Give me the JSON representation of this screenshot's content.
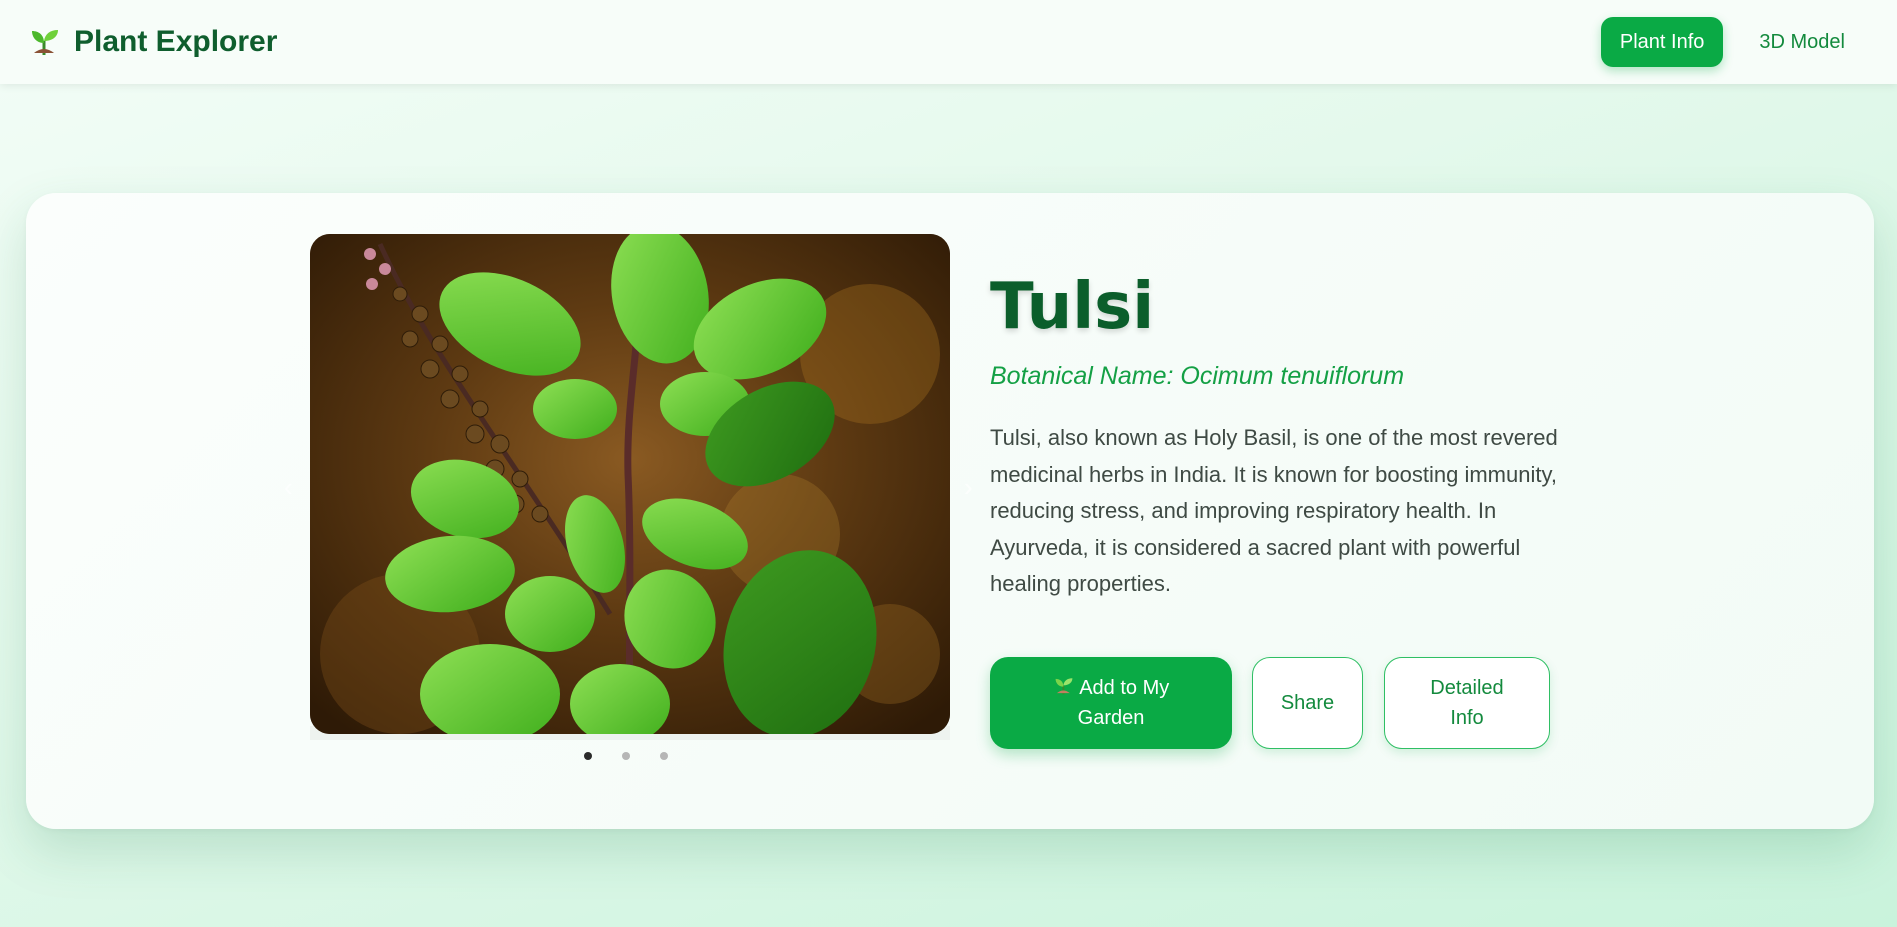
{
  "app": {
    "title": "Plant Explorer",
    "logo_icon": "seedling-icon"
  },
  "nav": {
    "items": [
      {
        "label": "Plant Info",
        "active": true
      },
      {
        "label": "3D Model",
        "active": false
      }
    ]
  },
  "carousel": {
    "image_alt": "Tulsi plant",
    "slide_count": 3,
    "active_slide": 1,
    "prev_icon": "chevron-left-icon",
    "next_icon": "chevron-right-icon"
  },
  "plant": {
    "name": "Tulsi",
    "botanical": "Botanical Name: Ocimum tenuiflorum",
    "description": "Tulsi, also known as Holy Basil, is one of the most revered medicinal herbs in India. It is known for boosting immunity, reducing stress, and improving respiratory health. In Ayurveda, it is considered a sacred plant with powerful healing properties."
  },
  "actions": {
    "add_label": "Add to My Garden",
    "add_icon": "seedling-icon",
    "share_label": "Share",
    "detail_label": "Detailed Info"
  },
  "colors": {
    "primary": "#0aaa45",
    "dark_green": "#0b5e2b",
    "accent_text": "#14a045"
  }
}
